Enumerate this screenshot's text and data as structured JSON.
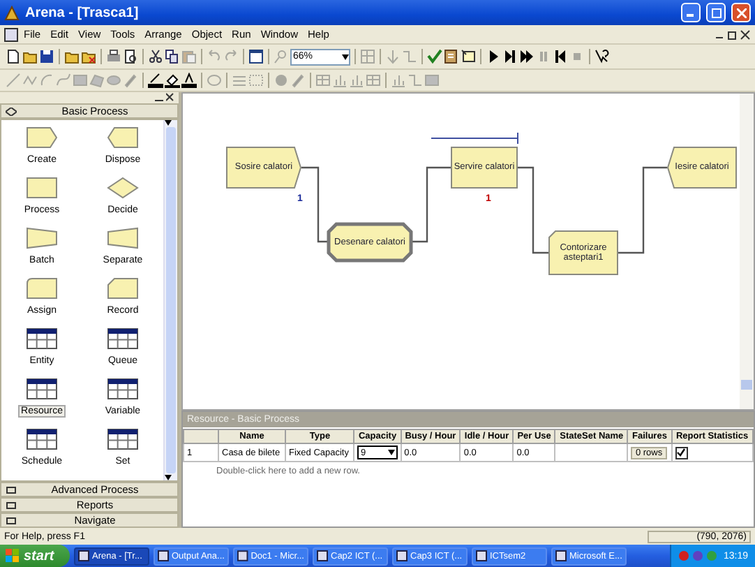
{
  "window": {
    "title": "Arena - [Trasca1]"
  },
  "menu": [
    "File",
    "Edit",
    "View",
    "Tools",
    "Arrange",
    "Object",
    "Run",
    "Window",
    "Help"
  ],
  "zoom": {
    "value": "66%"
  },
  "project_bar": {
    "panels": [
      {
        "title": "Basic Process",
        "expanded": true,
        "modules": [
          {
            "label": "Create",
            "kind": "create",
            "selected": false
          },
          {
            "label": "Dispose",
            "kind": "dispose",
            "selected": false
          },
          {
            "label": "Process",
            "kind": "process",
            "selected": false
          },
          {
            "label": "Decide",
            "kind": "decide",
            "selected": false
          },
          {
            "label": "Batch",
            "kind": "batch",
            "selected": false
          },
          {
            "label": "Separate",
            "kind": "separate",
            "selected": false
          },
          {
            "label": "Assign",
            "kind": "assign",
            "selected": false
          },
          {
            "label": "Record",
            "kind": "record",
            "selected": false
          },
          {
            "label": "Entity",
            "kind": "data",
            "selected": false
          },
          {
            "label": "Queue",
            "kind": "data",
            "selected": false
          },
          {
            "label": "Resource",
            "kind": "data",
            "selected": true
          },
          {
            "label": "Variable",
            "kind": "data",
            "selected": false
          },
          {
            "label": "Schedule",
            "kind": "data",
            "selected": false
          },
          {
            "label": "Set",
            "kind": "data",
            "selected": false
          }
        ]
      },
      {
        "title": "Advanced Process",
        "expanded": false
      },
      {
        "title": "Reports",
        "expanded": false
      },
      {
        "title": "Navigate",
        "expanded": false
      }
    ]
  },
  "model": {
    "nodes": [
      {
        "label": "Sosire calatori",
        "kind": "create",
        "counter": "1",
        "color": "#1a2a9a"
      },
      {
        "label": "Desenare calatori",
        "kind": "station"
      },
      {
        "label": "Servire calatori",
        "kind": "process",
        "counter": "1",
        "color": "#c00000"
      },
      {
        "label": "Contorizare asteptari1",
        "kind": "record"
      },
      {
        "label": "Iesire calatori",
        "kind": "dispose"
      }
    ]
  },
  "spreadsheet": {
    "title": "Resource - Basic Process",
    "columns": [
      "Name",
      "Type",
      "Capacity",
      "Busy / Hour",
      "Idle / Hour",
      "Per Use",
      "StateSet Name",
      "Failures",
      "Report Statistics"
    ],
    "rows": [
      {
        "number": "1",
        "name": "Casa de bilete",
        "type": "Fixed Capacity",
        "capacity": "9",
        "busy_per_hour": "0.0",
        "idle_per_hour": "0.0",
        "per_use": "0.0",
        "failures": "0 rows",
        "report_statistics": true
      }
    ],
    "add_row_hint": "Double-click here to add a new row."
  },
  "status_bar": {
    "help": "For Help, press F1",
    "coordinates": "(790, 2076)"
  },
  "taskbar": {
    "start": "start",
    "items": [
      {
        "label": "Arena - [Tr...",
        "selected": true
      },
      {
        "label": "Output Ana...",
        "selected": false
      },
      {
        "label": "Doc1 - Micr...",
        "selected": false
      },
      {
        "label": "Cap2 ICT (...",
        "selected": false
      },
      {
        "label": "Cap3 ICT (...",
        "selected": false
      },
      {
        "label": "ICTsem2",
        "selected": false
      },
      {
        "label": "Microsoft E...",
        "selected": false
      }
    ],
    "clock": "13:19"
  }
}
